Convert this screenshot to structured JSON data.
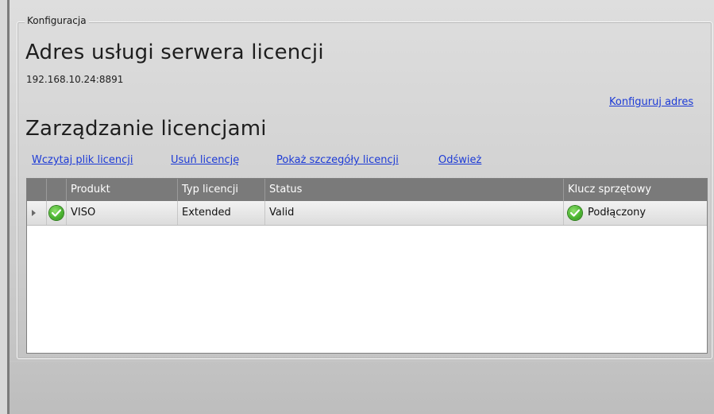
{
  "group": {
    "legend": "Konfiguracja"
  },
  "server": {
    "title": "Adres usługi serwera licencji",
    "address": "192.168.10.24:8891",
    "configure_link": "Konfiguruj adres"
  },
  "licenses": {
    "title": "Zarządzanie licencjami",
    "actions": {
      "load": "Wczytaj plik licencji",
      "remove": "Usuń licencję",
      "details": "Pokaż szczegóły licencji",
      "refresh": "Odśwież"
    },
    "columns": {
      "product": "Produkt",
      "type": "Typ licencji",
      "status": "Status",
      "key": "Klucz sprzętowy"
    },
    "rows": [
      {
        "status_icon": "check-circle-icon",
        "product": "VISO",
        "type": "Extended",
        "status": "Valid",
        "key_icon": "check-circle-icon",
        "key": "Podłączony"
      }
    ]
  },
  "colors": {
    "link": "#1d3bd6",
    "header_bg": "#7a7a7a",
    "ok_green": "#4cb531"
  }
}
